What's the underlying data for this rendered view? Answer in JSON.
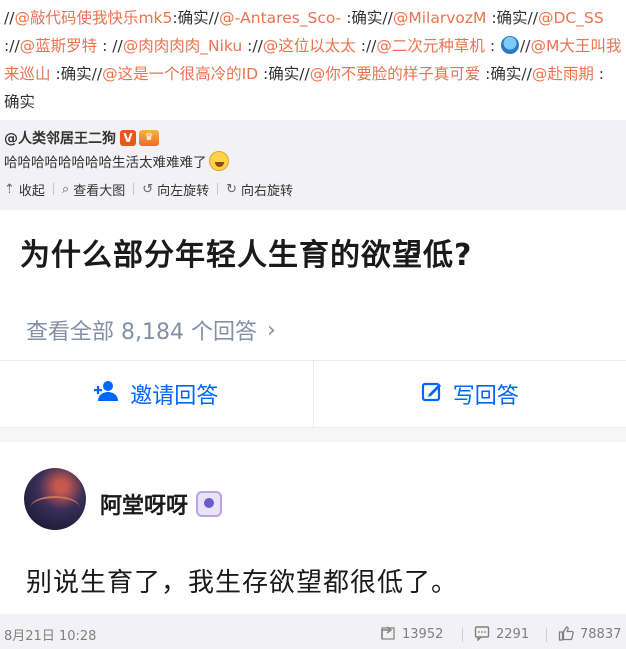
{
  "repost_chain": [
    {
      "type": "sep",
      "text": "//"
    },
    {
      "type": "user",
      "text": "@敲代码使我快乐mk5"
    },
    {
      "type": "text",
      "text": ":确实//"
    },
    {
      "type": "user",
      "text": "@-Antares_Sco-"
    },
    {
      "type": "text",
      "text": " :确实//"
    },
    {
      "type": "user",
      "text": "@MilarvozM"
    },
    {
      "type": "text",
      "text": " :确实//"
    },
    {
      "type": "user",
      "text": "@DC_SS"
    },
    {
      "type": "text",
      "text": " ://"
    },
    {
      "type": "user",
      "text": "@蓝斯罗特"
    },
    {
      "type": "text",
      "text": " : //"
    },
    {
      "type": "user",
      "text": "@肉肉肉肉_Niku"
    },
    {
      "type": "text",
      "text": " ://"
    },
    {
      "type": "user",
      "text": "@这位以太太"
    },
    {
      "type": "text",
      "text": " ://"
    },
    {
      "type": "user",
      "text": "@二次元种草机"
    },
    {
      "type": "text",
      "text": " : "
    },
    {
      "type": "emoji",
      "text": ""
    },
    {
      "type": "text",
      "text": "//"
    },
    {
      "type": "user",
      "text": "@M大王叫我来巡山"
    },
    {
      "type": "text",
      "text": " :确实//"
    },
    {
      "type": "user",
      "text": "@这是一个很高冷的ID"
    },
    {
      "type": "text",
      "text": " :确实//"
    },
    {
      "type": "user",
      "text": "@你不要脸的样子真可爱"
    },
    {
      "type": "text",
      "text": " :确实//"
    },
    {
      "type": "user",
      "text": "@赴雨期"
    },
    {
      "type": "text",
      "text": " : 确实"
    }
  ],
  "quoted_post": {
    "author": "@人类邻居王二狗",
    "v_badge": "V",
    "text": "哈哈哈哈哈哈哈哈生活太难难难了",
    "toolbar": {
      "collapse": "收起",
      "view_large": "查看大图",
      "rotate_left": "向左旋转",
      "rotate_right": "向右旋转"
    }
  },
  "question_card": {
    "title": "为什么部分年轻人生育的欲望低?",
    "view_all": "查看全部 8,184 个回答",
    "invite": "邀请回答",
    "write": "写回答"
  },
  "answer": {
    "author": "阿堂呀呀",
    "text": "别说生育了，我生存欲望都很低了。"
  },
  "footer": {
    "time": "8月21日 10:28",
    "reposts": "13952",
    "comments": "2291",
    "likes": "78837"
  },
  "colors": {
    "link": "#eb7350",
    "zhihu_blue": "#0066ff",
    "muted": "#8590a6"
  }
}
